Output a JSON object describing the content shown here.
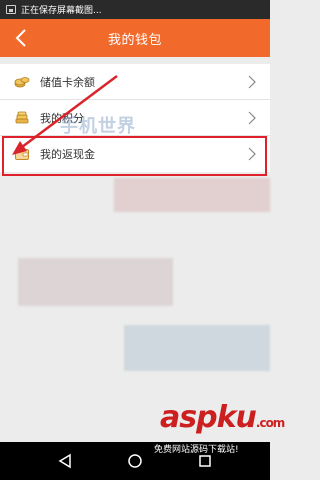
{
  "status_bar": {
    "text": "正在保存屏幕截图..."
  },
  "header": {
    "title": "我的钱包",
    "back_icon": "chevron-left-icon"
  },
  "menu": {
    "items": [
      {
        "label": "储值卡余额",
        "icon": "coins-icon"
      },
      {
        "label": "我的积分",
        "icon": "coin-stack-icon"
      },
      {
        "label": "我的返现金",
        "icon": "wallet-icon"
      }
    ]
  },
  "watermarks": {
    "site_name": "手机世界",
    "aspku_brand": "aspku",
    "aspku_suffix": ".com",
    "aspku_tagline": "免费网站源码下载站!"
  },
  "colors": {
    "header": "#f26a2b",
    "highlight": "#e0212b",
    "background": "#ececec"
  },
  "navigation": {
    "buttons": [
      "back-icon",
      "home-icon",
      "recents-icon"
    ]
  }
}
